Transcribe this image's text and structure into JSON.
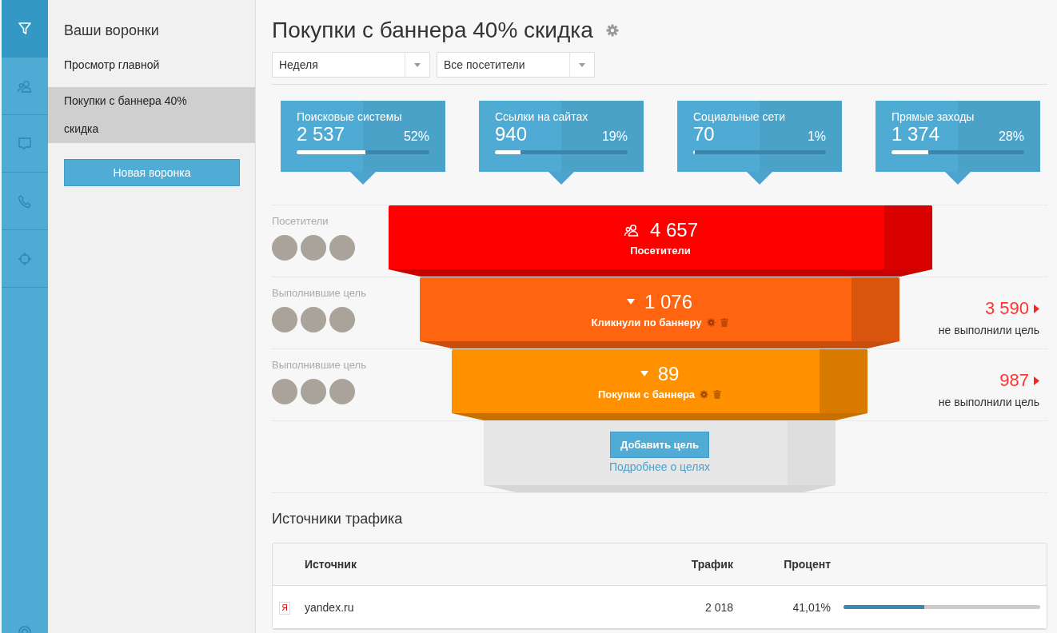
{
  "rail": [
    {
      "kind": "funnel",
      "selected": true
    },
    {
      "kind": "people",
      "selected": false
    },
    {
      "kind": "chat",
      "selected": false
    },
    {
      "kind": "phone",
      "selected": false
    },
    {
      "kind": "target",
      "selected": false
    }
  ],
  "sidebar": {
    "title": "Ваши воронки",
    "items": [
      {
        "label": "Просмотр главной",
        "selected": false
      },
      {
        "label": "Покупки с баннера 40% скидка",
        "selected": true
      }
    ],
    "new_button": "Новая воронка"
  },
  "page_title": "Покупки с баннера 40% скидка",
  "filters": [
    {
      "value": "Неделя"
    },
    {
      "value": "Все посетители"
    }
  ],
  "sources": [
    {
      "label": "Поисковые системы",
      "value": "2 537",
      "percent": "52%",
      "level": 0.52
    },
    {
      "label": "Ссылки на сайтах",
      "value": "940",
      "percent": "19%",
      "level": 0.19
    },
    {
      "label": "Социальные сети",
      "value": "70",
      "percent": "1%",
      "level": 0.01
    },
    {
      "label": "Прямые заходы",
      "value": "1 374",
      "percent": "28%",
      "level": 0.28
    }
  ],
  "stages": [
    {
      "kind": "visitors",
      "group": "Посетители",
      "count": "4 657",
      "label": "Посетители",
      "color": "#ff0000"
    },
    {
      "kind": "goal",
      "group": "Выполнившие цель",
      "count": "1 076",
      "label": "Кликнули по баннеру",
      "color": "#ff6410",
      "lost": "3 590",
      "lost_label": "не выполнили цель"
    },
    {
      "kind": "goal",
      "group": "Выполнившие цель",
      "count": "89",
      "label": "Покупки с баннера",
      "color": "#ff9000",
      "lost": "987",
      "lost_label": "не выполнили цель"
    }
  ],
  "add_goal": {
    "button": "Добавить цель",
    "link": "Подробнее о целях"
  },
  "traffic": {
    "title": "Источники трафика",
    "columns": [
      "Источник",
      "Трафик",
      "Процент"
    ],
    "rows": [
      {
        "favicon": "Я",
        "source": "yandex.ru",
        "traffic": "2 018",
        "percent": "41,01%",
        "level": 0.4101
      }
    ]
  }
}
